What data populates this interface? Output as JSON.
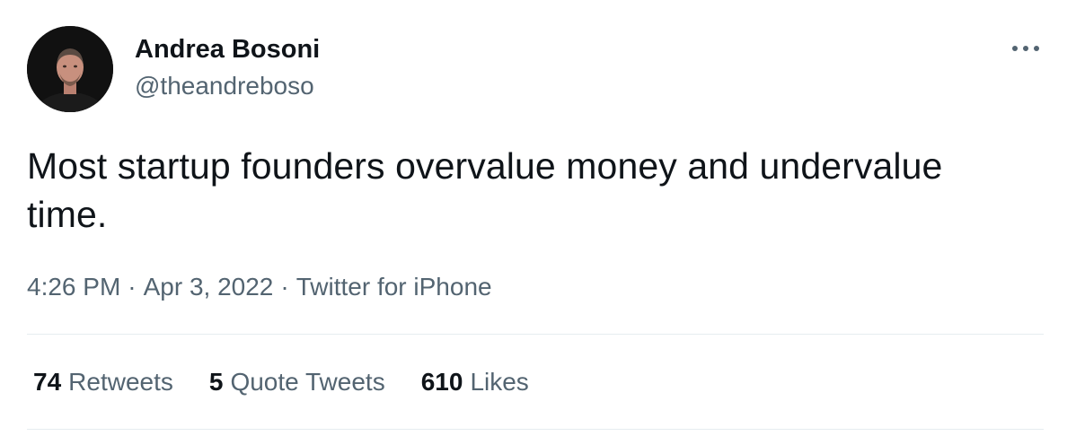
{
  "author": {
    "name": "Andrea Bosoni",
    "handle": "@theandreboso",
    "avatar_icon": "profile-photo"
  },
  "tweet": {
    "text": "Most startup founders overvalue money and undervalue time.",
    "time": "4:26 PM",
    "date": "Apr 3, 2022",
    "source": "Twitter for iPhone",
    "separator": "·"
  },
  "stats": {
    "retweets": {
      "count": "74",
      "label": "Retweets"
    },
    "quote_tweets": {
      "count": "5",
      "label": "Quote Tweets"
    },
    "likes": {
      "count": "610",
      "label": "Likes"
    }
  },
  "menu": {
    "more_icon": "more-horizontal-icon"
  },
  "colors": {
    "primary_text": "#0f1419",
    "secondary_text": "#536471",
    "divider": "#e6ecf0",
    "background": "#ffffff"
  }
}
